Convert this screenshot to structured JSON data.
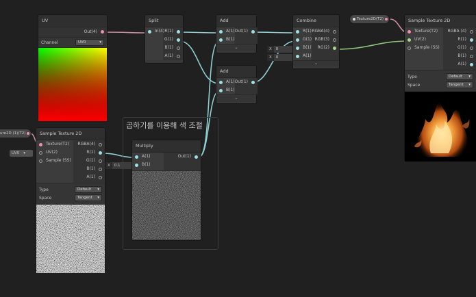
{
  "colors": {
    "wire_vector": "#8fcfd4",
    "wire_pink": "#c98ca4",
    "wire_green": "#8ec27a",
    "port_fill": "#9ee0e6"
  },
  "uv_node": {
    "title": "UV",
    "output": "Out(4)",
    "channel_label": "Channel",
    "channel_value": "UV0"
  },
  "split_node": {
    "title": "Split",
    "input": "In(4)",
    "outputs": [
      "R(1)",
      "G(1)",
      "B(1)",
      "A(1)"
    ]
  },
  "add1_node": {
    "title": "Add",
    "inputs": [
      "A(1)",
      "B(1)"
    ],
    "output": "Out(1)",
    "expand_icon": "chevron-down-icon"
  },
  "add2_node": {
    "title": "Add",
    "inputs": [
      "A(1)",
      "B(1)"
    ],
    "output": "Out(1)",
    "expand_icon": "chevron-down-icon"
  },
  "combine_node": {
    "title": "Combine",
    "inputs": [
      "R(1)",
      "G(1)",
      "B(1)",
      "A(1)"
    ],
    "outputs": [
      "RGBA(4)",
      "RGB(3)",
      "RG(2)"
    ],
    "inline_b": {
      "x": "X",
      "value": "0"
    },
    "inline_a": {
      "x": "X",
      "value": "0"
    }
  },
  "sample_right": {
    "title": "Sample Texture 2D",
    "inputs": [
      "Texture(T2)",
      "UV(2)",
      "Sample (SS)"
    ],
    "outputs": [
      "RGBA (4)",
      "R(1)",
      "G(1)",
      "B(1)",
      "A(1)"
    ],
    "type_label": "Type",
    "type_value": "Default",
    "space_label": "Space",
    "space_value": "Tangent"
  },
  "tex_pill_right": {
    "label": "Texture2D(T2)"
  },
  "tex_pill_left": {
    "label": "ure2D (1)(T2)"
  },
  "group": {
    "title": "곱하기를 이용해 색 조절"
  },
  "sample_left": {
    "title": "Sample Texture 2D",
    "inputs": [
      "Texture(T2)",
      "UV(2)",
      "Sample (SS)"
    ],
    "outputs": [
      "RGBA(4)",
      "R(1)",
      "G(1)",
      "B(1)",
      "A(1)"
    ],
    "type_label": "Type",
    "type_value": "Default",
    "space_label": "Space",
    "space_value": "Tangent",
    "uv_inline": "UV0"
  },
  "multiply_node": {
    "title": "Multiply",
    "inputs": [
      "A(1)",
      "B(1)"
    ],
    "output": "Out(1)",
    "inline_b": {
      "x": "X",
      "value": "0.1"
    }
  }
}
